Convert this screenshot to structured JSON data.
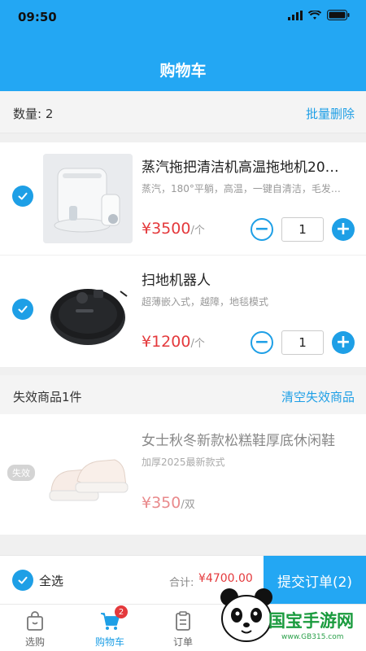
{
  "status": {
    "time": "09:50"
  },
  "header": {
    "title": "购物车"
  },
  "cart": {
    "count_label": "数量: 2",
    "batch_delete": "批量删除",
    "items": [
      {
        "title": "蒸汽拖把清洁机高温拖地机20…",
        "desc": "蒸汽，180°平躺，高温，一键自清洁，毛发…",
        "price": "¥3500",
        "unit": "/个",
        "qty": "1",
        "checked": true
      },
      {
        "title": "扫地机器人",
        "desc": "超薄嵌入式，越障，地毯模式",
        "price": "¥1200",
        "unit": "/个",
        "qty": "1",
        "checked": true
      }
    ]
  },
  "invalid": {
    "title": "失效商品1件",
    "clear": "清空失效商品",
    "badge": "失效",
    "item": {
      "title": "女士秋冬新款松糕鞋厚底休闲鞋",
      "desc": "加厚2025最新款式",
      "price": "¥350",
      "unit": "/双"
    }
  },
  "footer": {
    "select_all": "全选",
    "total_label": "合计:",
    "total_value": "¥4700.00",
    "submit": "提交订单(2)"
  },
  "tabs": [
    {
      "label": "选购",
      "icon": "bag-icon"
    },
    {
      "label": "购物车",
      "icon": "cart-icon",
      "badge": "2",
      "active": true
    },
    {
      "label": "订单",
      "icon": "clipboard-icon"
    }
  ],
  "watermark": {
    "text": "国宝手游网",
    "sub": "www.GB315.com"
  },
  "colors": {
    "accent": "#23a7f3",
    "price": "#e4393c"
  }
}
